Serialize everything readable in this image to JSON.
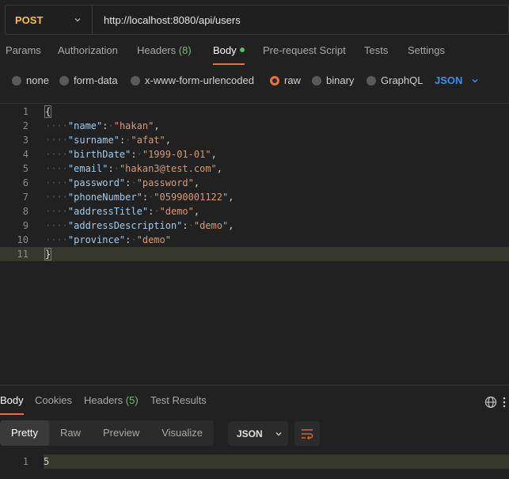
{
  "request": {
    "method": "POST",
    "url": "http://localhost:8080/api/users"
  },
  "request_tabs": [
    {
      "label": "Params"
    },
    {
      "label": "Authorization"
    },
    {
      "label": "Headers",
      "count": "(8)"
    },
    {
      "label": "Body"
    },
    {
      "label": "Pre-request Script"
    },
    {
      "label": "Tests"
    },
    {
      "label": "Settings"
    }
  ],
  "body_types": [
    "none",
    "form-data",
    "x-www-form-urlencoded",
    "raw",
    "binary",
    "GraphQL"
  ],
  "body_type_selected": "raw",
  "body_language": "JSON",
  "editor": {
    "line_numbers": [
      "1",
      "2",
      "3",
      "4",
      "5",
      "6",
      "7",
      "8",
      "9",
      "10",
      "11"
    ],
    "open_brace": "{",
    "close_brace": "}",
    "fields": [
      {
        "key": "\"name\"",
        "value": "\"hakan\""
      },
      {
        "key": "\"surname\"",
        "value": "\"afat\""
      },
      {
        "key": "\"birthDate\"",
        "value": "\"1999-01-01\""
      },
      {
        "key": "\"email\"",
        "value": "\"hakan3@test.com\""
      },
      {
        "key": "\"password\"",
        "value": "\"password\""
      },
      {
        "key": "\"phoneNumber\"",
        "value": "\"05990001122\""
      },
      {
        "key": "\"addressTitle\"",
        "value": "\"demo\""
      },
      {
        "key": "\"addressDescription\"",
        "value": "\"demo\""
      },
      {
        "key": "\"province\"",
        "value": "\"demo\""
      }
    ]
  },
  "response_tabs": [
    {
      "label": "Body"
    },
    {
      "label": "Cookies"
    },
    {
      "label": "Headers",
      "count": "(5)"
    },
    {
      "label": "Test Results"
    }
  ],
  "response_views": [
    "Pretty",
    "Raw",
    "Preview",
    "Visualize"
  ],
  "response_format": "JSON",
  "response_body": {
    "line": "1",
    "text": "5"
  },
  "colors": {
    "accent": "#e8703c",
    "method": "#f5c04a",
    "link": "#3f8ee8",
    "success": "#4cbf6a"
  }
}
